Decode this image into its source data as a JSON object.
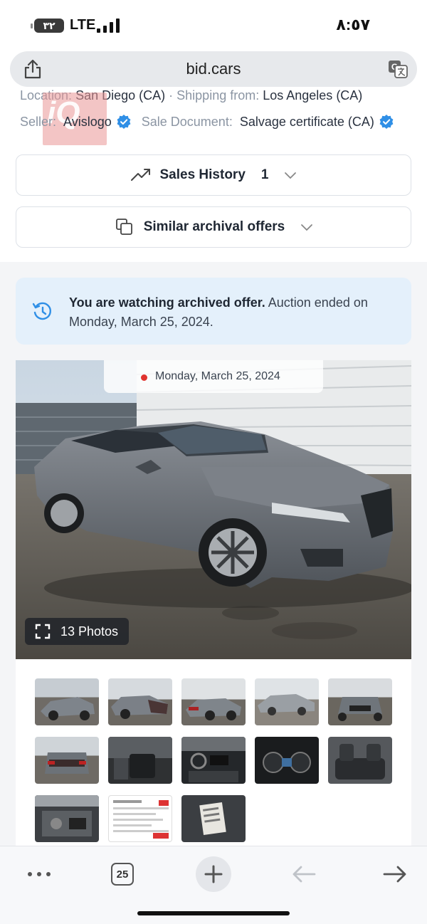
{
  "status_bar": {
    "battery": "٣٢",
    "network": "LTE",
    "time": "٨:٥٧"
  },
  "browser": {
    "url": "bid.cars",
    "share_icon": "share-icon",
    "translate_icon": "translate-icon"
  },
  "listing": {
    "location_label": "Location:",
    "location_value": "San Diego (CA)",
    "shipping_label": "Shipping from:",
    "shipping_value": "Los Angeles (CA)",
    "seller_label": "Seller:",
    "seller_value": "Avislogo",
    "sale_doc_label": "Sale Document:",
    "sale_doc_value": "Salvage certificate (CA)"
  },
  "accordions": {
    "sales_history_label": "Sales History",
    "sales_history_count": "1",
    "similar_label": "Similar archival offers"
  },
  "notice": {
    "bold": "You are watching archived offer.",
    "rest": " Auction ended on Monday, March 25, 2024."
  },
  "gallery": {
    "date": "Monday, March 25, 2024",
    "photos_label": "13 Photos",
    "thumb_count": 13,
    "status_color": "#e0332e"
  },
  "toolbar": {
    "more_icon": "more-icon",
    "tabs_count": "25",
    "new_tab_icon": "plus-icon",
    "back_icon": "back-arrow-icon",
    "forward_icon": "forward-arrow-icon"
  },
  "colors": {
    "accent_blue": "#2f8fe6",
    "notice_bg": "#e4f0fb"
  }
}
